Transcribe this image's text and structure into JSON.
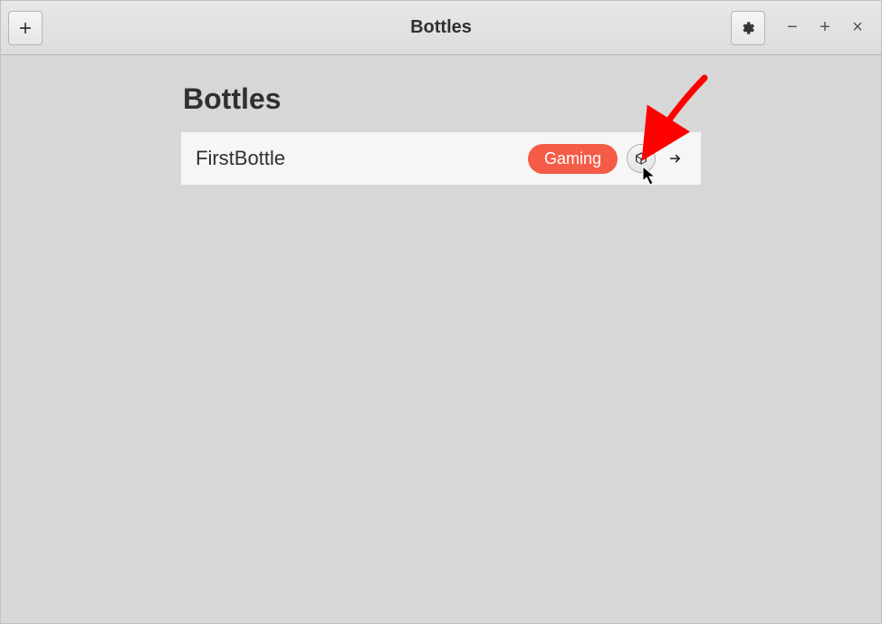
{
  "header": {
    "title": "Bottles",
    "add_button": "+",
    "settings_icon": "gear",
    "minimize": "−",
    "maximize": "+",
    "close": "×"
  },
  "page": {
    "title": "Bottles"
  },
  "bottles": [
    {
      "name": "FirstBottle",
      "badge": "Gaming"
    }
  ],
  "colors": {
    "badge_bg": "#f55c47",
    "badge_fg": "#ffffff",
    "annotation": "#ff0000"
  }
}
